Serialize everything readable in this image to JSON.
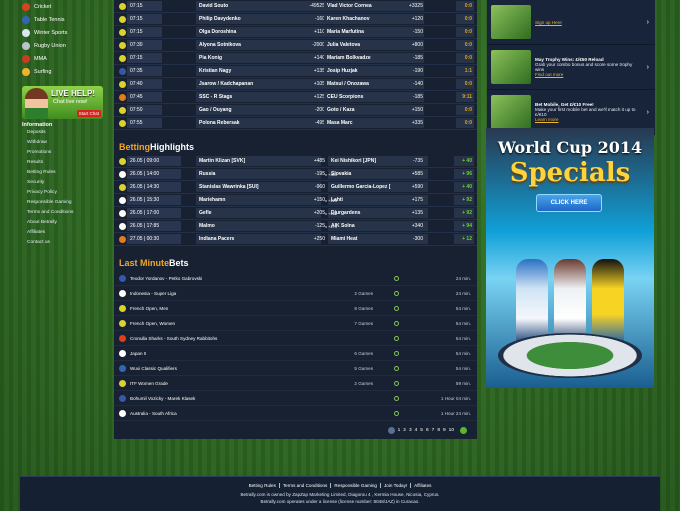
{
  "sports": [
    {
      "label": "Cricket",
      "color": "#d8421d"
    },
    {
      "label": "Table Tennis",
      "color": "#3365b5"
    },
    {
      "label": "Winter Sports",
      "color": "#d9e6ef"
    },
    {
      "label": "Rugby Union",
      "color": "#b7c3cf"
    },
    {
      "label": "MMA",
      "color": "#c83d22"
    },
    {
      "label": "Surfing",
      "color": "#f2b12a"
    }
  ],
  "live_help": {
    "title": "LIVE HELP!",
    "subtitle": "Chat live now!",
    "button": "Start Chat"
  },
  "info_title": "Information",
  "info_items": [
    "Deposits",
    "Withdraw",
    "Promotions",
    "Results",
    "Betting Rules",
    "Security",
    "Privacy Policy",
    "Responsible Gaming",
    "Terms and Conditions",
    "About Betrally",
    "Affiliates",
    "Contact us"
  ],
  "live_events": [
    {
      "time": "07:15",
      "home": "David Souto",
      "home_odd": "-49525",
      "away": "Vlad Victor Cornea",
      "away_odd": "+3325",
      "score": "0:0",
      "color": "#d9d22f"
    },
    {
      "time": "07:15",
      "home": "Philip Davydenko",
      "home_odd": "-160",
      "away": "Karen Khachanov",
      "away_odd": "+120",
      "score": "0:0",
      "color": "#d9d22f"
    },
    {
      "time": "07:15",
      "home": "Olga Doroshina",
      "home_odd": "+110",
      "away": "Maria Marfutina",
      "away_odd": "-150",
      "score": "0:0",
      "color": "#d9d22f"
    },
    {
      "time": "07:30",
      "home": "Alyona Sotnikova",
      "home_odd": "-2000",
      "away": "Julia Valetova",
      "away_odd": "+800",
      "score": "0:0",
      "color": "#d9d22f"
    },
    {
      "time": "07:15",
      "home": "Pia Konig",
      "home_odd": "+140",
      "away": "Mariam Bolkvadze",
      "away_odd": "-185",
      "score": "0:0",
      "color": "#d9d22f"
    },
    {
      "time": "07:35",
      "home": "Kristian Nagy",
      "home_odd": "+135",
      "away": "Josip Huzjak",
      "away_odd": "-190",
      "score": "1:1",
      "color": "#3558a8"
    },
    {
      "time": "07:40",
      "home": "Jsarow / Kadchapanan",
      "home_odd": "+105",
      "away": "Matsui / Onozawa",
      "away_odd": "-140",
      "score": "0:0",
      "color": "#d9d22f"
    },
    {
      "time": "07:45",
      "home": "SSC - R Stags",
      "home_odd": "+125",
      "away": "CEU Scorpions",
      "away_odd": "-185",
      "score": "9:11",
      "color": "#e47c1c"
    },
    {
      "time": "07:50",
      "home": "Gao / Ouyang",
      "home_odd": "-200",
      "away": "Goto / Kaza",
      "away_odd": "+150",
      "score": "0:0",
      "color": "#d9d22f"
    },
    {
      "time": "07:55",
      "home": "Polona Rebersak",
      "home_odd": "-495",
      "away": "Masa Marc",
      "away_odd": "+335",
      "score": "0:0",
      "color": "#d9d22f"
    }
  ],
  "highlights_title_a": "Betting",
  "highlights_title_b": "Highlights",
  "highlights": [
    {
      "time": "26.05 | 09:00",
      "home": "Martin Klizan [SVK]",
      "home_odd": "+485",
      "away": "Kei Nishikori [JPN]",
      "away_odd": "-735",
      "more": "+ 40",
      "color": "#d9d22f"
    },
    {
      "time": "26.05 | 14:00",
      "home": "Russia",
      "home_odd": "-195",
      "x": "x +300",
      "away": "Slovakia",
      "away_odd": "+585",
      "more": "+ 96",
      "color": "#ffffff"
    },
    {
      "time": "26.05 | 14:30",
      "home": "Stanislas Wawrinka [SUI]",
      "home_odd": "-960",
      "away": "Guillermo Garcia-Lopez [",
      "away_odd": "+590",
      "more": "+ 40",
      "color": "#d9d22f"
    },
    {
      "time": "26.05 | 15:30",
      "home": "Mariehamn",
      "home_odd": "+150",
      "x": "x +225",
      "away": "Lahti",
      "away_odd": "+175",
      "more": "+ 92",
      "color": "#ffffff"
    },
    {
      "time": "26.05 | 17:00",
      "home": "Gefle",
      "home_odd": "+205",
      "x": "x +225",
      "away": "Djurgardens",
      "away_odd": "+135",
      "more": "+ 92",
      "color": "#ffffff"
    },
    {
      "time": "26.05 | 17:85",
      "home": "Malmo",
      "home_odd": "-125",
      "x": "x +270",
      "away": "AIK Solna",
      "away_odd": "+340",
      "more": "+ 94",
      "color": "#ffffff"
    },
    {
      "time": "27.05 | 00:30",
      "home": "Indiana Pacers",
      "home_odd": "+250",
      "away": "Miami Heat",
      "away_odd": "-300",
      "more": "+ 12",
      "color": "#e47c1c"
    }
  ],
  "lastminute_title_a": "Last Minute",
  "lastminute_title_b": "Bets",
  "last_minute": [
    {
      "name": "Teodor Yordanov - Petko Gabrovski",
      "games": "",
      "time": "24 min.",
      "color": "#3558a8"
    },
    {
      "name": "Indonesia - Super Liga",
      "games": "2 Games",
      "time": "24 min.",
      "color": "#ffffff"
    },
    {
      "name": "French Open, Men",
      "games": "8 Games",
      "time": "54 min.",
      "color": "#d9d22f"
    },
    {
      "name": "French Open, Women",
      "games": "7 Games",
      "time": "54 min.",
      "color": "#d9d22f"
    },
    {
      "name": "Cronulla Sharks - South Sydney Rabbitohs",
      "games": "",
      "time": "54 min.",
      "color": "#d8421d"
    },
    {
      "name": "Japan II",
      "games": "6 Games",
      "time": "54 min.",
      "color": "#ffffff"
    },
    {
      "name": "Wuxi Classic Qualifiers",
      "games": "5 Games",
      "time": "54 min.",
      "color": "#3365b5"
    },
    {
      "name": "ITF Women Grade",
      "games": "2 Games",
      "time": "59 min.",
      "color": "#d9d22f"
    },
    {
      "name": "Bohumil Vozicky - Marek Klasek",
      "games": "",
      "time": "1 Hour 04 min.",
      "color": "#3558a8"
    },
    {
      "name": "Australia - South Africa",
      "games": "",
      "time": "1 Hour 24 min.",
      "color": "#ffffff"
    }
  ],
  "pages": [
    "1",
    "2",
    "3",
    "4",
    "5",
    "6",
    "7",
    "8",
    "9",
    "10"
  ],
  "ads": [
    {
      "title": "",
      "text": "",
      "link": "Sign up Here"
    },
    {
      "title": "May Trophy Wins: £/€50 Reload",
      "text": "Grab your combo bonus and score some trophy wins",
      "link": "Find out more"
    },
    {
      "title": "Bet Mobile, Get £/€10 Free!",
      "text": "Make your first mobile bet and we'll match it up to £/€10",
      "link": "Learn more"
    }
  ],
  "worldcup": {
    "title": "World Cup 2014",
    "subtitle": "Specials",
    "button": "CLICK HERE"
  },
  "footer_links": [
    "Betting Rules",
    "Terms and Conditions",
    "Responsible Gaming",
    "Join Today!",
    "Affiliates"
  ],
  "footer_text1": "Betrally.com is owned by ZapZap Marketing Limited, Diagorou 4 , Kermia House, Nicosia, Cyprus.",
  "footer_text2": "Betrally.com operates under a license (license number: 8048/JAZ) in Curacao."
}
